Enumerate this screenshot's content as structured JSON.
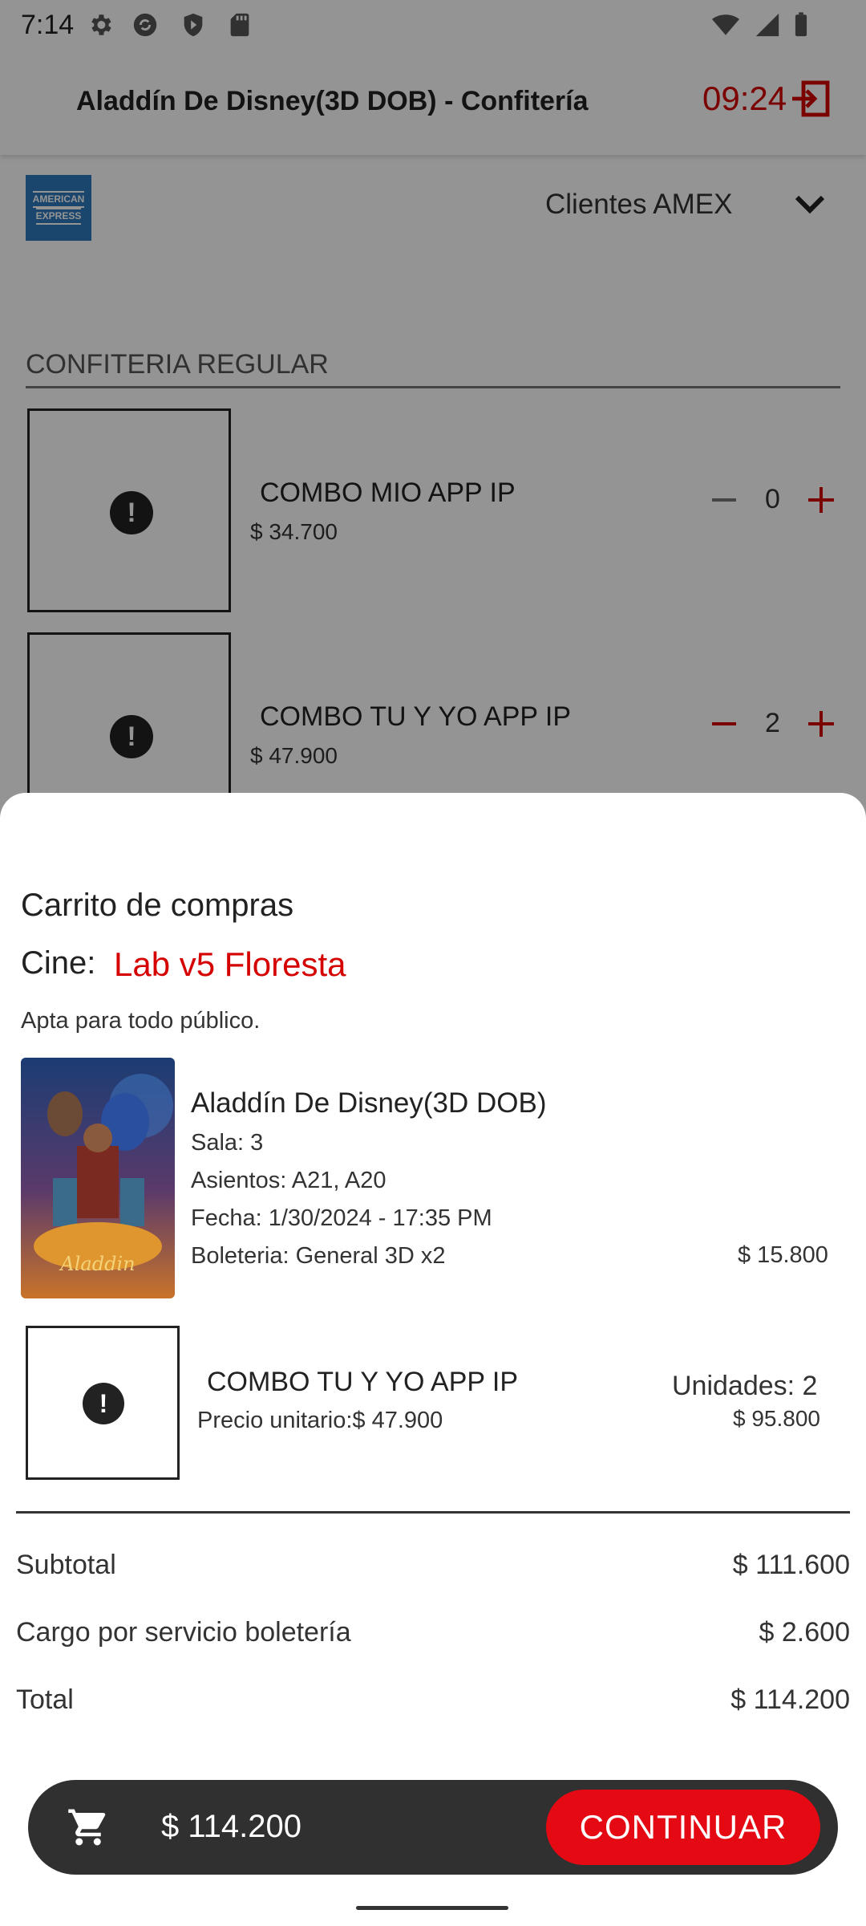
{
  "status_bar": {
    "time": "7:14",
    "icons": [
      "gear-icon",
      "sync-icon",
      "shield-play-icon",
      "sd-card-icon",
      "wifi-icon",
      "signal-icon",
      "battery-icon"
    ]
  },
  "header": {
    "title": "Aladdín De Disney(3D DOB) - Confitería",
    "timer": "09:24",
    "exit_icon": "exit-icon"
  },
  "payment": {
    "selected_option": "Clientes AMEX",
    "logo_lines": [
      "AMERICAN",
      "EXPRESS"
    ]
  },
  "catalog": {
    "section_title": "CONFITERIA REGULAR",
    "products": [
      {
        "name": "COMBO MIO APP IP",
        "price": "$ 34.700",
        "qty": "0"
      },
      {
        "name": "COMBO TU Y YO APP IP",
        "price": "$ 47.900",
        "qty": "2"
      }
    ]
  },
  "cart": {
    "title": "Carrito de compras",
    "cine_label": "Cine:",
    "cine_name": "Lab v5 Floresta",
    "rating": "Apta para todo público.",
    "movie": {
      "title": "Aladdín De Disney(3D DOB)",
      "sala": "Sala: 3",
      "asientos": "Asientos: A21, A20",
      "fecha": "Fecha: 1/30/2024 - 17:35 PM",
      "boleteria": "Boleteria: General 3D x2",
      "price": "$ 15.800",
      "poster_text": "Aladdin"
    },
    "combo": {
      "name": "COMBO TU Y YO APP IP",
      "unit_price": "Precio unitario:$ 47.900",
      "units": "Unidades: 2",
      "total": "$ 95.800"
    },
    "summary": {
      "subtotal_label": "Subtotal",
      "subtotal_value": "$ 111.600",
      "fee_label": "Cargo por servicio boletería",
      "fee_value": "$ 2.600",
      "total_label": "Total",
      "total_value": "$ 114.200"
    }
  },
  "bottom_bar": {
    "total": "$ 114.200",
    "continue_label": "CONTINUAR"
  },
  "colors": {
    "accent": "#d50000",
    "button": "#e50914",
    "bar": "#303030"
  }
}
